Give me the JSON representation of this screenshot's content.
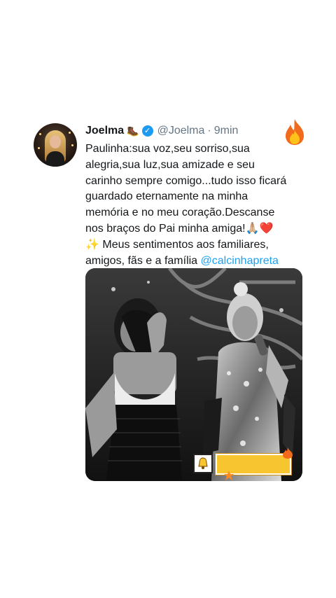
{
  "tweet": {
    "author": {
      "name": "Joelma",
      "emoji": "🥾",
      "verified": true,
      "handle": "@Joelma",
      "separator": "·",
      "time": "9min"
    },
    "reaction_icon": "fire-icon",
    "text_lines": [
      "Paulinha:sua voz,seu sorriso,sua",
      "alegria,sua luz,sua amizade e seu",
      "carinho sempre comigo...tudo isso ficará",
      "guardado eternamente na minha",
      "memória e no meu coração.Descanse",
      "nos braços do Pai minha amiga!"
    ],
    "line6_emojis": [
      "🙏🏼",
      "❤️"
    ],
    "line7_sparkle": "✨",
    "line7_text": "Meus sentimentos aos familiares,",
    "line8_text": "amigos, fãs e a família",
    "mention": "@calcinhapreta",
    "media": {
      "type": "photo",
      "stickers": [
        "bell-icon",
        "flame-icon",
        "star-icon"
      ]
    }
  },
  "colors": {
    "link": "#1da1f2",
    "secondary_text": "#657786",
    "verified": "#1d9bf0",
    "sticker_yellow": "#f7c530"
  }
}
